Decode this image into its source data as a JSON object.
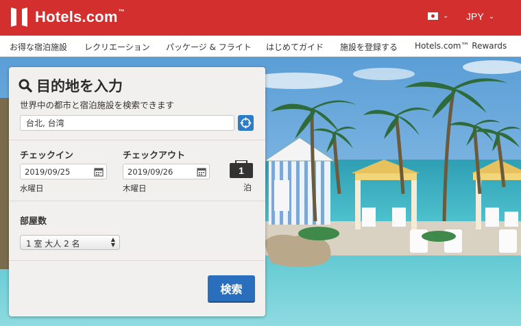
{
  "header": {
    "logo_text": "Hotels.com",
    "logo_tm": "™",
    "currency": "JPY",
    "locale_icon": "japan-flag-icon",
    "brand_color": "#d32f2f"
  },
  "nav": {
    "items": [
      {
        "label": "お得な宿泊施設"
      },
      {
        "label": "レクリエーション"
      },
      {
        "label": "パッケージ & フライト"
      },
      {
        "label": "はじめてガイド"
      },
      {
        "label": "施設を登録する"
      },
      {
        "label": "Hotels.com™ Rewards"
      }
    ]
  },
  "search": {
    "title": "目的地を入力",
    "subtitle": "世界中の都市と宿泊施設を検索できます",
    "destination_value": "台北, 台湾",
    "checkin_label": "チェックイン",
    "checkin_value": "2019/09/25",
    "checkin_dow": "水曜日",
    "checkout_label": "チェックアウト",
    "checkout_value": "2019/09/26",
    "checkout_dow": "木曜日",
    "nights_count": "1",
    "nights_label": "泊",
    "rooms_label": "部屋数",
    "rooms_value": "1 室 大人 2 名",
    "search_button": "検索",
    "accent_color": "#2a6fbd"
  }
}
